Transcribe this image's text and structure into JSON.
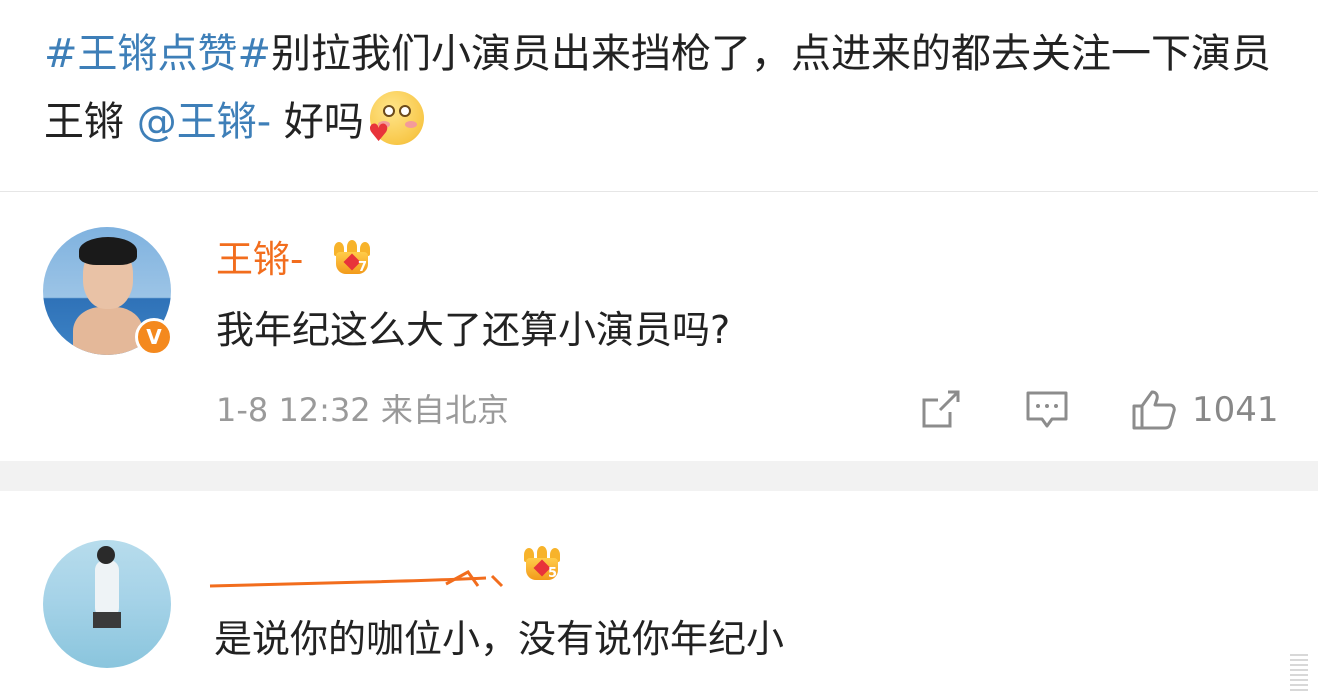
{
  "post": {
    "topic": "#王锵点赞#",
    "text_part1": "别拉我们小演员出来挡枪了，点进来的都去关注一下演员王锵",
    "mention": "@王锵-",
    "text_part2": "好吗"
  },
  "comments": [
    {
      "username": "王锵-",
      "crown_level": "7",
      "verified_mark": "V",
      "text": "我年纪这么大了还算小演员吗?",
      "meta": "1-8 12:32 来自北京",
      "like_count": "1041"
    },
    {
      "crown_level": "5",
      "text": "是说你的咖位小，没有说你年纪小"
    }
  ],
  "icons": {
    "share": "share-icon",
    "comment": "comment-icon",
    "like": "thumbs-up-icon"
  },
  "colors": {
    "topic_link": "#3e7fb8",
    "username": "#f26d1d",
    "verified_badge": "#f4891e"
  }
}
